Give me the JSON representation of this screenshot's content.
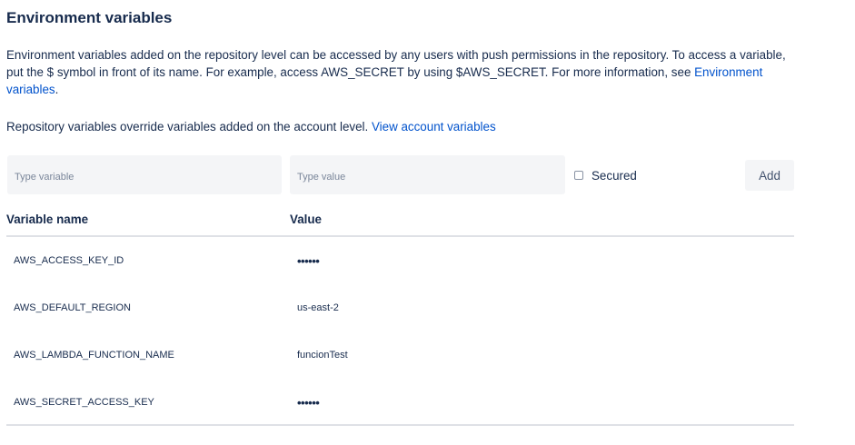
{
  "page": {
    "title": "Environment variables",
    "description_part1": "Environment variables added on the repository level can be accessed by any users with push permissions in the repository. To access a variable, put the $ symbol in front of its name. For example, access AWS_SECRET by using $AWS_SECRET. For more information, see ",
    "description_link": "Environment variables",
    "description_part1_end": ".",
    "description2": "Repository variables override variables added on the account level. ",
    "description2_link": "View account variables"
  },
  "form": {
    "name_placeholder": "Type variable",
    "value_placeholder": "Type value",
    "secured_label": "Secured",
    "add_label": "Add"
  },
  "table": {
    "headers": {
      "name": "Variable name",
      "value": "Value"
    },
    "rows": [
      {
        "name": "AWS_ACCESS_KEY_ID",
        "value": "••••••",
        "secured": true
      },
      {
        "name": "AWS_DEFAULT_REGION",
        "value": "us-east-2",
        "secured": false
      },
      {
        "name": "AWS_LAMBDA_FUNCTION_NAME",
        "value": "funcionTest",
        "secured": false
      },
      {
        "name": "AWS_SECRET_ACCESS_KEY",
        "value": "••••••",
        "secured": true
      }
    ]
  },
  "colors": {
    "text": "#172B4D",
    "link": "#0052CC",
    "field_bg": "#F4F5F7",
    "divider": "#DFE1E6"
  }
}
